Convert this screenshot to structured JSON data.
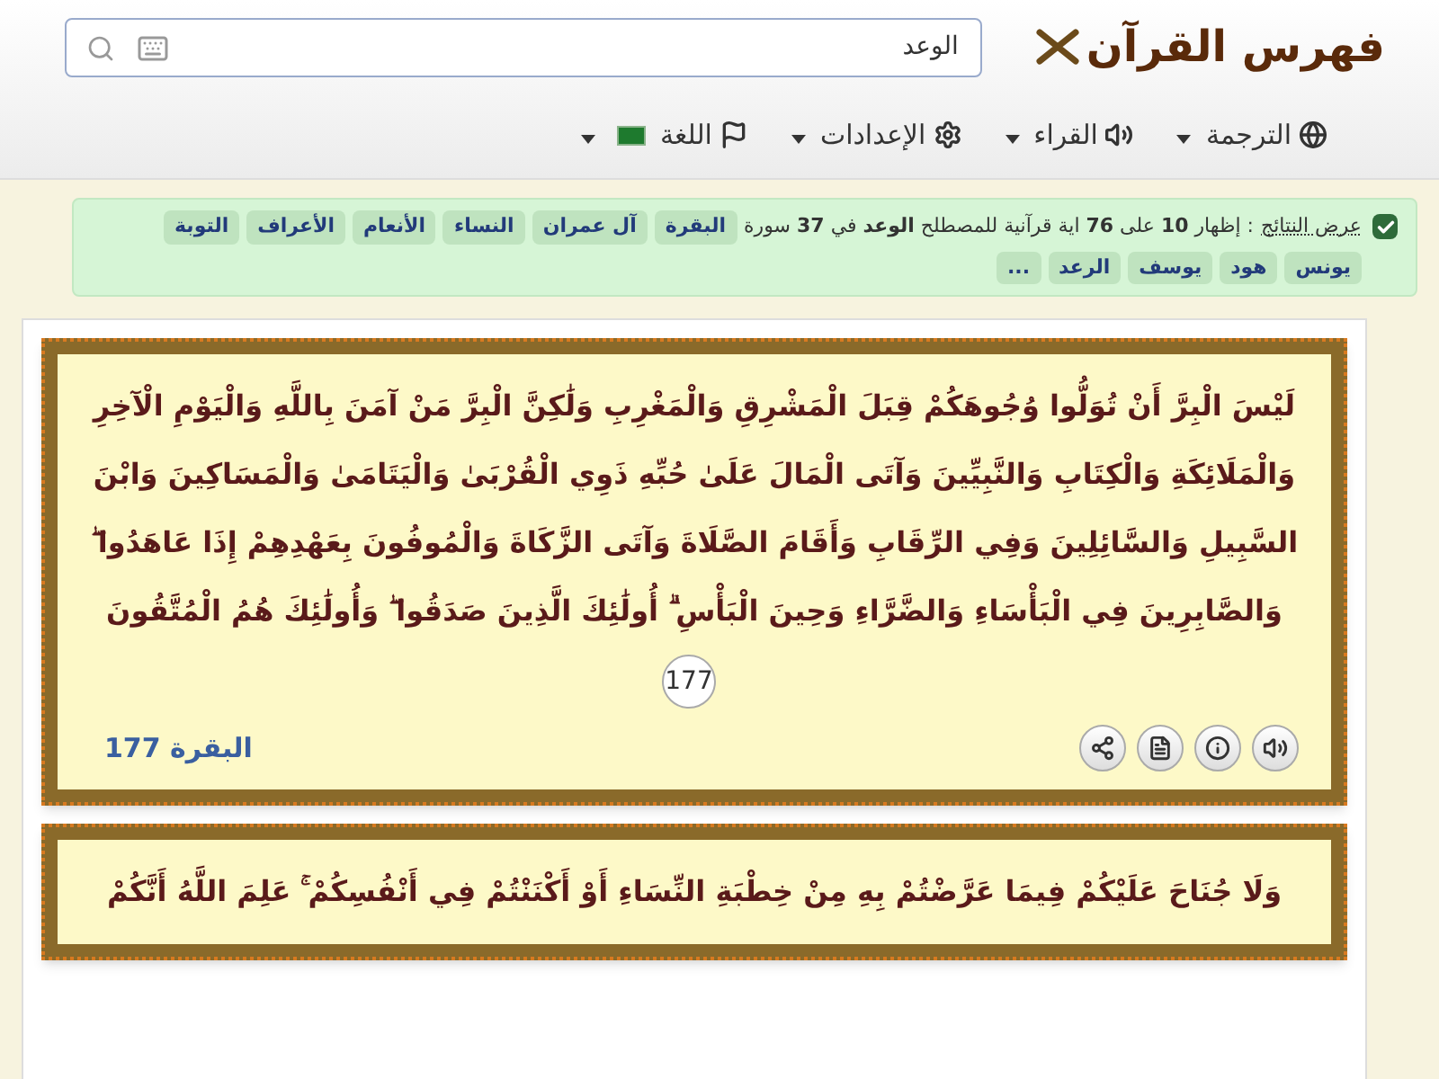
{
  "header": {
    "logo": "فهرس القرآن",
    "search": {
      "value": "الوعد"
    },
    "menus": [
      {
        "label": "الترجمة"
      },
      {
        "label": "القراء"
      },
      {
        "label": "الإعدادات"
      },
      {
        "label": "اللغة"
      }
    ]
  },
  "results": {
    "checked": true,
    "link": "عرض النتائج",
    "summary": ": إظهار **10** على **76** اية قرآنية للمصطلح **الوعد** في **37** سورة",
    "surahs": [
      "البقرة",
      "آل عمران",
      "النساء",
      "الأنعام",
      "الأعراف",
      "التوبة",
      "يونس",
      "هود",
      "يوسف",
      "الرعد",
      "..."
    ]
  },
  "verses": [
    {
      "text": "لَيْسَ الْبِرَّ أَنْ تُوَلُّوا وُجُوهَكُمْ قِبَلَ الْمَشْرِقِ وَالْمَغْرِبِ وَلَٰكِنَّ الْبِرَّ مَنْ آمَنَ بِاللَّهِ وَالْيَوْمِ الْآخِرِ وَالْمَلَائِكَةِ وَالْكِتَابِ وَالنَّبِيِّينَ وَآتَى الْمَالَ عَلَىٰ حُبِّهِ ذَوِي الْقُرْبَىٰ وَالْيَتَامَىٰ وَالْمَسَاكِينَ وَابْنَ السَّبِيلِ وَالسَّائِلِينَ وَفِي الرِّقَابِ وَأَقَامَ الصَّلَاةَ وَآتَى الزَّكَاةَ وَالْمُوفُونَ بِعَهْدِهِمْ إِذَا عَاهَدُوا ۖ وَالصَّابِرِينَ فِي الْبَأْسَاءِ وَالضَّرَّاءِ وَحِينَ الْبَأْسِ ۗ أُولَٰئِكَ الَّذِينَ صَدَقُوا ۖ وَأُولَٰئِكَ هُمُ الْمُتَّقُونَ",
      "number": "177",
      "reference": "البقرة 177"
    },
    {
      "text": "وَلَا جُنَاحَ عَلَيْكُمْ فِيمَا عَرَّضْتُمْ بِهِ مِنْ خِطْبَةِ النِّسَاءِ أَوْ أَكْنَنْتُمْ فِي أَنْفُسِكُمْ ۚ عَلِمَ اللَّهُ أَنَّكُمْ"
    }
  ]
}
